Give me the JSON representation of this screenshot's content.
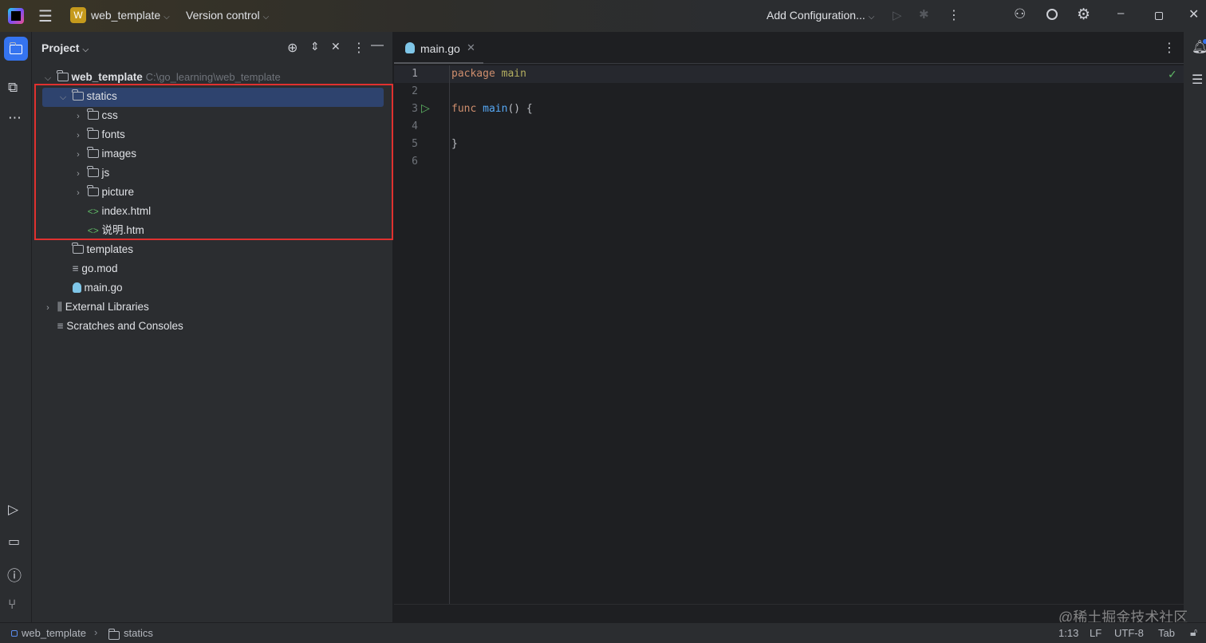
{
  "topbar": {
    "project_badge": "W",
    "project_name": "web_template",
    "vcs": "Version control",
    "run_config": "Add Configuration..."
  },
  "panel": {
    "title": "Project"
  },
  "tree": [
    {
      "label": "web_template",
      "path": "C:\\go_learning\\web_template",
      "level": 0,
      "type": "folder",
      "expanded": true
    },
    {
      "label": "statics",
      "level": 1,
      "type": "folder",
      "expanded": true,
      "selected": true
    },
    {
      "label": "css",
      "level": 2,
      "type": "folder",
      "expanded": false
    },
    {
      "label": "fonts",
      "level": 2,
      "type": "folder",
      "expanded": false
    },
    {
      "label": "images",
      "level": 2,
      "type": "folder",
      "expanded": false
    },
    {
      "label": "js",
      "level": 2,
      "type": "folder",
      "expanded": false
    },
    {
      "label": "picture",
      "level": 2,
      "type": "folder",
      "expanded": false
    },
    {
      "label": "index.html",
      "level": 2,
      "type": "html"
    },
    {
      "label": "说明.htm",
      "level": 2,
      "type": "html"
    },
    {
      "label": "templates",
      "level": 1,
      "type": "folder"
    },
    {
      "label": "go.mod",
      "level": 1,
      "type": "mod"
    },
    {
      "label": "main.go",
      "level": 1,
      "type": "go"
    },
    {
      "label": "External Libraries",
      "level": 0,
      "type": "lib",
      "expanded": false
    },
    {
      "label": "Scratches and Consoles",
      "level": 0,
      "type": "scratch"
    }
  ],
  "editor": {
    "tab": "main.go",
    "lines": [
      "1",
      "2",
      "3",
      "4",
      "5",
      "6"
    ],
    "code": {
      "l1_kw": "package",
      "l1_name": "main",
      "l3_kw": "func",
      "l3_fn": "main",
      "l3_rest": "() {",
      "l5": "}"
    }
  },
  "status": {
    "crumb_project": "web_template",
    "crumb_folder": "statics",
    "position": "1:13",
    "line_sep": "LF",
    "encoding": "UTF-8",
    "indent": "Tab"
  },
  "watermark": "@稀土掘金技术社区",
  "colors": {
    "selection": "#2e436e",
    "highlight_box": "#e0312f",
    "keyword": "#cf8e6d",
    "function": "#56a8f5",
    "accent": "#3574f0"
  }
}
